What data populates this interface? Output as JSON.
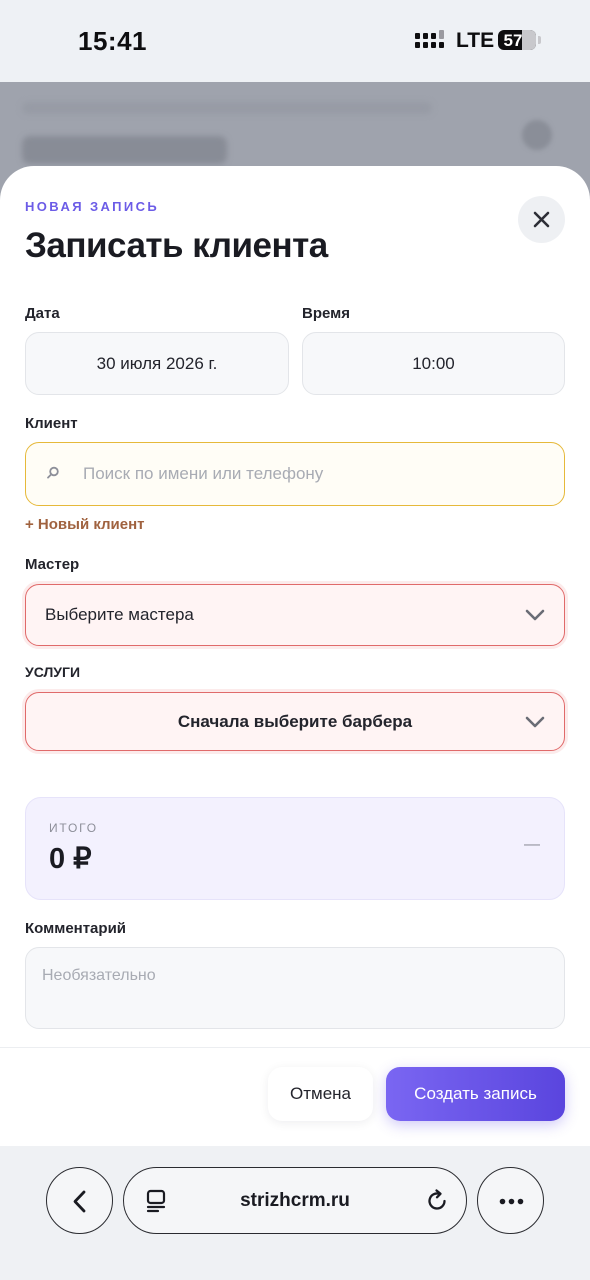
{
  "status_bar": {
    "time": "15:41",
    "network": "LTE",
    "battery": "57"
  },
  "modal": {
    "eyebrow": "НОВАЯ ЗАПИСЬ",
    "title": "Записать клиента",
    "date": {
      "label": "Дата",
      "value": "30 июля 2026 г."
    },
    "time": {
      "label": "Время",
      "value": "10:00"
    },
    "client": {
      "label": "Клиент",
      "placeholder": "Поиск по имени или телефону",
      "new_client_link": "+ Новый клиент"
    },
    "master": {
      "label": "Мастер",
      "placeholder": "Выберите мастера"
    },
    "services": {
      "label": "УСЛУГИ",
      "placeholder": "Сначала выберите барбера"
    },
    "total": {
      "label": "ИТОГО",
      "value": "0 ₽",
      "dash": "—"
    },
    "comment": {
      "label": "Комментарий",
      "placeholder": "Необязательно"
    },
    "cancel_label": "Отмена",
    "submit_label": "Создать запись"
  },
  "browser": {
    "url": "strizhcrm.ru"
  },
  "colors": {
    "accent": "#6c5ce7",
    "button_gradient_start": "#7a66f2",
    "button_gradient_end": "#5a45de",
    "error_border": "#e06a6a",
    "warning_border": "#e6b93a",
    "link": "#a0623f"
  }
}
